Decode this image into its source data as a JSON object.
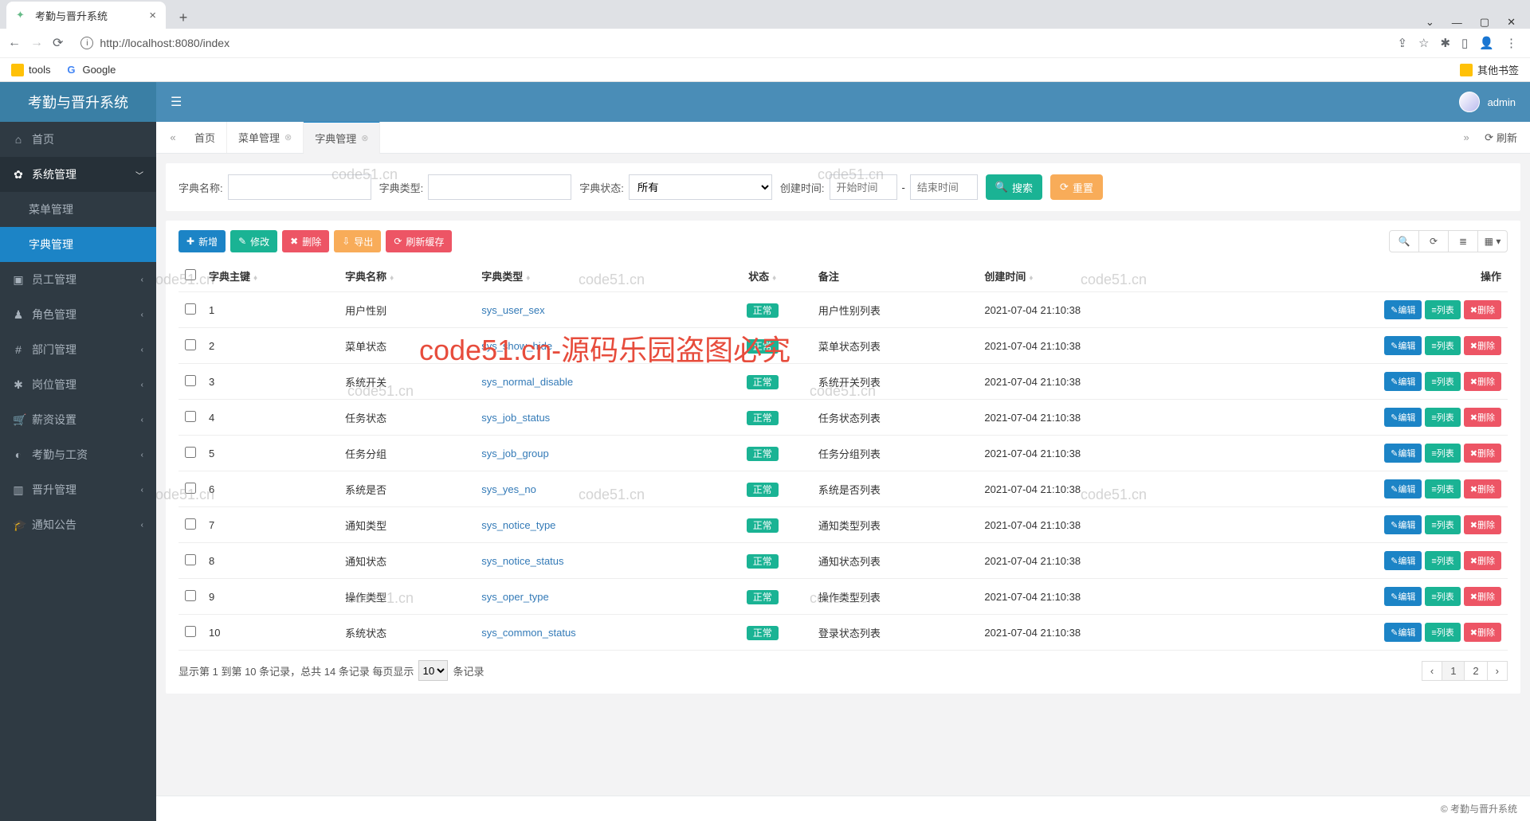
{
  "browser": {
    "tab_title": "考勤与晋升系统",
    "url": "http://localhost:8080/index",
    "bookmarks": {
      "tools": "tools",
      "google": "Google",
      "other": "其他书签"
    }
  },
  "app": {
    "brand": "考勤与晋升系统",
    "user": "admin"
  },
  "sidebar": {
    "home": "首页",
    "sys_mgmt": "系统管理",
    "menu_mgmt": "菜单管理",
    "dict_mgmt": "字典管理",
    "staff_mgmt": "员工管理",
    "role_mgmt": "角色管理",
    "dept_mgmt": "部门管理",
    "post_mgmt": "岗位管理",
    "salary_set": "薪资设置",
    "attendance_salary": "考勤与工资",
    "promotion_mgmt": "晋升管理",
    "notice": "通知公告"
  },
  "tabs": {
    "home": "首页",
    "menu_mgmt": "菜单管理",
    "dict_mgmt": "字典管理",
    "refresh": "刷新"
  },
  "search": {
    "dict_name_label": "字典名称:",
    "dict_type_label": "字典类型:",
    "dict_status_label": "字典状态:",
    "dict_status_value": "所有",
    "create_time_label": "创建时间:",
    "start_placeholder": "开始时间",
    "end_placeholder": "结束时间",
    "search_btn": "搜索",
    "reset_btn": "重置",
    "dash": "-"
  },
  "toolbar": {
    "add": "新增",
    "edit": "修改",
    "delete": "删除",
    "export": "导出",
    "refresh_cache": "刷新缓存"
  },
  "table": {
    "headers": {
      "dict_id": "字典主键",
      "dict_name": "字典名称",
      "dict_type": "字典类型",
      "status": "状态",
      "remark": "备注",
      "create_time": "创建时间",
      "ops": "操作"
    },
    "status_normal": "正常",
    "actions": {
      "edit": "编辑",
      "list": "列表",
      "delete": "删除"
    },
    "rows": [
      {
        "id": "1",
        "name": "用户性别",
        "type": "sys_user_sex",
        "remark": "用户性别列表",
        "time": "2021-07-04 21:10:38"
      },
      {
        "id": "2",
        "name": "菜单状态",
        "type": "sys_show_hide",
        "remark": "菜单状态列表",
        "time": "2021-07-04 21:10:38"
      },
      {
        "id": "3",
        "name": "系统开关",
        "type": "sys_normal_disable",
        "remark": "系统开关列表",
        "time": "2021-07-04 21:10:38"
      },
      {
        "id": "4",
        "name": "任务状态",
        "type": "sys_job_status",
        "remark": "任务状态列表",
        "time": "2021-07-04 21:10:38"
      },
      {
        "id": "5",
        "name": "任务分组",
        "type": "sys_job_group",
        "remark": "任务分组列表",
        "time": "2021-07-04 21:10:38"
      },
      {
        "id": "6",
        "name": "系统是否",
        "type": "sys_yes_no",
        "remark": "系统是否列表",
        "time": "2021-07-04 21:10:38"
      },
      {
        "id": "7",
        "name": "通知类型",
        "type": "sys_notice_type",
        "remark": "通知类型列表",
        "time": "2021-07-04 21:10:38"
      },
      {
        "id": "8",
        "name": "通知状态",
        "type": "sys_notice_status",
        "remark": "通知状态列表",
        "time": "2021-07-04 21:10:38"
      },
      {
        "id": "9",
        "name": "操作类型",
        "type": "sys_oper_type",
        "remark": "操作类型列表",
        "time": "2021-07-04 21:10:38"
      },
      {
        "id": "10",
        "name": "系统状态",
        "type": "sys_common_status",
        "remark": "登录状态列表",
        "time": "2021-07-04 21:10:38"
      }
    ]
  },
  "pager": {
    "info_a": "显示第 1 到第 10 条记录，总共 14 条记录  每页显示",
    "page_size": "10",
    "info_b": "条记录",
    "prev": "‹",
    "p1": "1",
    "p2": "2",
    "next": "›"
  },
  "footer": {
    "copyright": "© 考勤与晋升系统"
  },
  "watermark": {
    "text": "code51.cn",
    "big": "code51.cn-源码乐园盗图必究"
  }
}
